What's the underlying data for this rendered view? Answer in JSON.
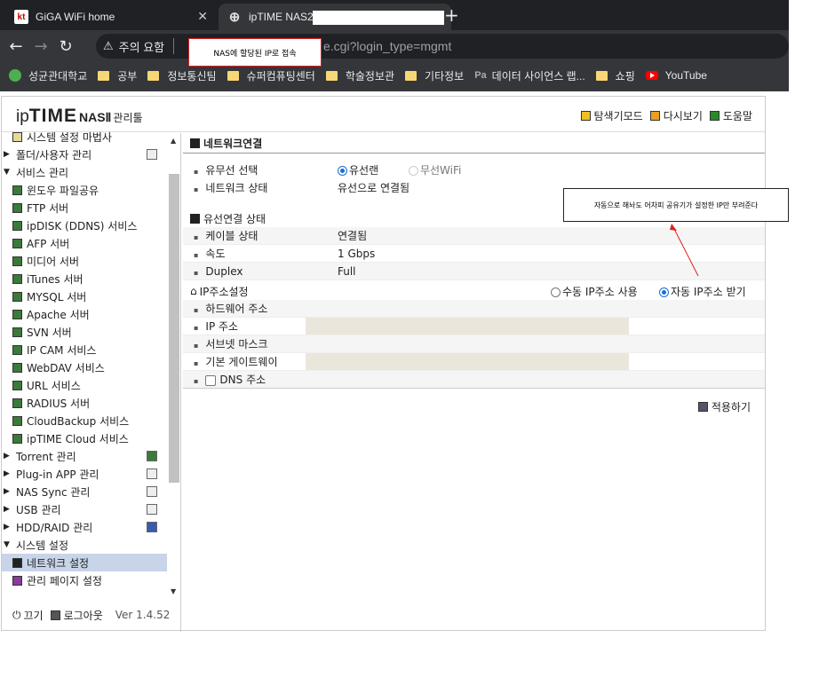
{
  "browser": {
    "tabs": [
      {
        "title": "GiGA WiFi home",
        "icon": "kt-favicon",
        "close": "✕"
      },
      {
        "title": "ipTIME NAS2",
        "icon": "globe-icon"
      }
    ],
    "new_tab": "+",
    "security_label": "주의 요함",
    "url": "e.cgi?login_type=mgmt",
    "bookmarks": [
      {
        "label": "성균관대학교",
        "icon": "skku-icon"
      },
      {
        "label": "공부",
        "icon": "folder-icon"
      },
      {
        "label": "정보통신팀",
        "icon": "folder-icon"
      },
      {
        "label": "슈퍼컴퓨팅센터",
        "icon": "folder-icon"
      },
      {
        "label": "학술정보관",
        "icon": "folder-icon"
      },
      {
        "label": "기타정보",
        "icon": "folder-icon"
      },
      {
        "label": "데이터 사이언스 랩...",
        "icon": "pa-icon"
      },
      {
        "label": "쇼핑",
        "icon": "folder-icon"
      },
      {
        "label": "YouTube",
        "icon": "youtube-icon"
      }
    ]
  },
  "annotations": {
    "callout1": "NAS에 할당된 IP로 접속",
    "callout2": "자동으로 해놔도 어차피 공유기가 설정한 IP만 부려준다"
  },
  "nas": {
    "logo": {
      "ip": "ip",
      "time": "TIME",
      "model": "NASⅡ",
      "suffix": "관리툴"
    },
    "header_links": [
      "탐색기모드",
      "다시보기",
      "도움말"
    ],
    "menu": {
      "partial_top": "시스템 설정 마법사",
      "folder_user": "폴더/사용자 관리",
      "service": "서비스 관리",
      "services": [
        "윈도우 파일공유",
        "FTP 서버",
        "ipDISK (DDNS) 서비스",
        "AFP 서버",
        "미디어 서버",
        "iTunes 서버",
        "MYSQL 서버",
        "Apache 서버",
        "SVN 서버",
        "IP CAM 서비스",
        "WebDAV 서비스",
        "URL 서비스",
        "RADIUS 서버",
        "CloudBackup 서비스",
        "ipTIME Cloud 서비스"
      ],
      "torrent": "Torrent 관리",
      "plugin": "Plug-in APP 관리",
      "nassync": "NAS Sync 관리",
      "usb": "USB 관리",
      "hdd": "HDD/RAID 관리",
      "system": "시스템 설정",
      "network": "네트워크 설정",
      "admin_page": "관리 페이지 설정"
    },
    "footer": {
      "off": "끄기",
      "logout": "로그아웃",
      "version": "Ver 1.4.52"
    },
    "main": {
      "title": "네트워크연결",
      "conn_type_label": "유무선 선택",
      "wired": "유선랜",
      "wireless": "무선WiFi",
      "net_status_label": "네트워크 상태",
      "net_status": "유선으로 연결됨",
      "wired_section": "유선연결 상태",
      "cable_label": "케이블 상태",
      "cable": "연결됨",
      "speed_label": "속도",
      "speed": "1 Gbps",
      "duplex_label": "Duplex",
      "duplex": "Full",
      "ip_section": "IP주소설정",
      "manual_ip": "수동 IP주소 사용",
      "auto_ip": "자동 IP주소 받기",
      "hw_label": "하드웨어 주소",
      "ip_label": "IP 주소",
      "subnet_label": "서브넷 마스크",
      "gateway_label": "기본 게이트웨이",
      "dns_label": "DNS 주소",
      "apply": "적용하기"
    }
  }
}
